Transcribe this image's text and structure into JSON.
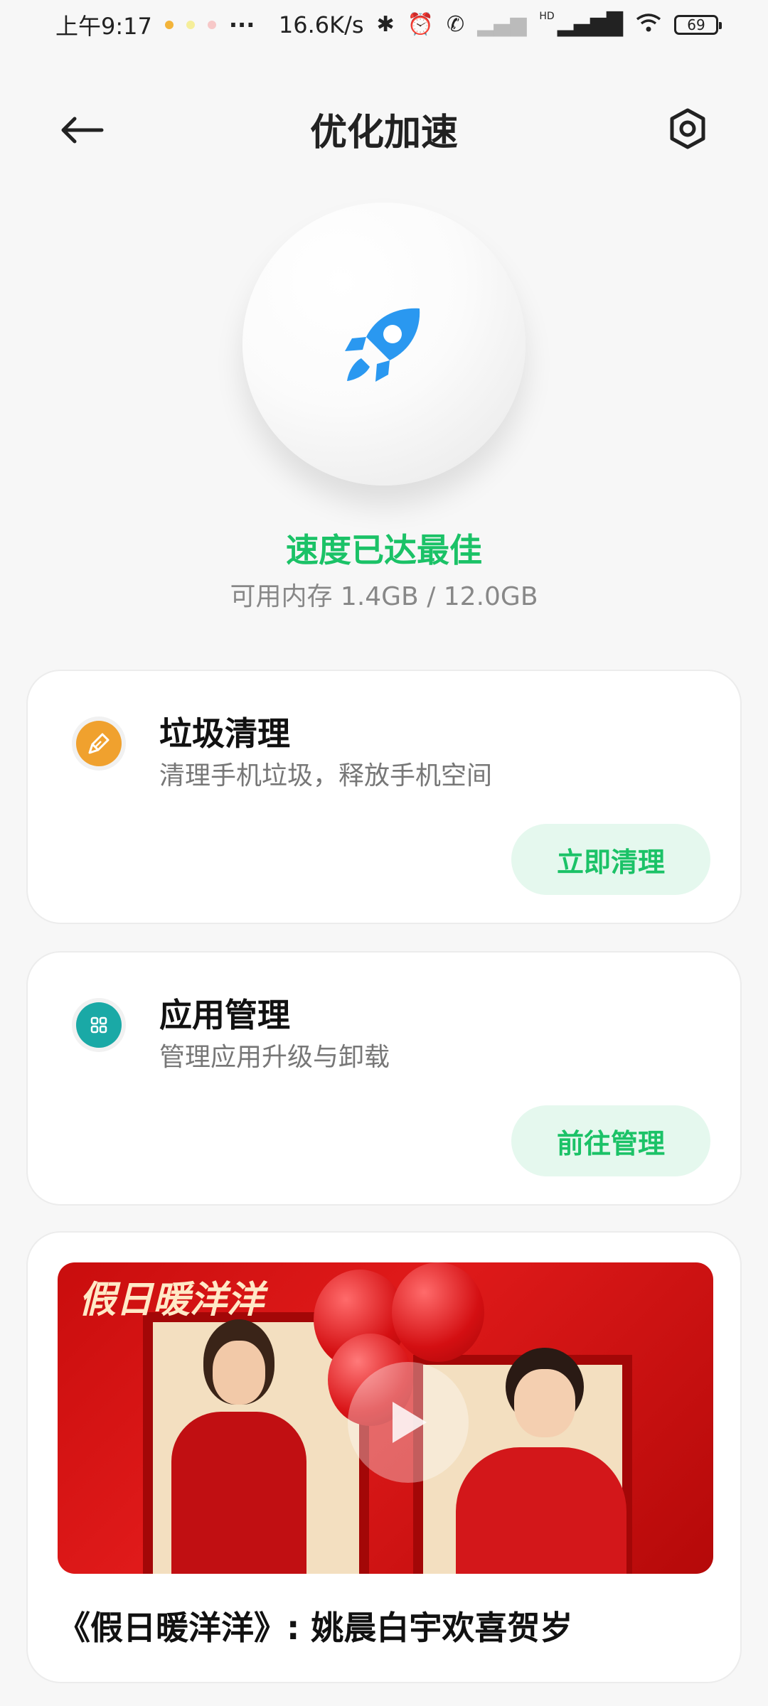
{
  "status_bar": {
    "time": "上午9:17",
    "more": "···",
    "net_speed": "16.6K/s",
    "battery": "69",
    "signal_label": "HD"
  },
  "header": {
    "title": "优化加速"
  },
  "hero": {
    "status": "速度已达最佳",
    "memory": "可用内存 1.4GB / 12.0GB"
  },
  "cards": [
    {
      "title": "垃圾清理",
      "description": "清理手机垃圾，释放手机空间",
      "button": "立即清理",
      "icon": "broom-icon",
      "icon_color": "#f0a12e"
    },
    {
      "title": "应用管理",
      "description": "管理应用升级与卸载",
      "button": "前往管理",
      "icon": "apps-grid-icon",
      "icon_color": "#1aa9a6"
    }
  ],
  "video": {
    "logo_text": "假日暖洋洋",
    "title": "《假日暖洋洋》: 姚晨白宇欢喜贺岁"
  },
  "colors": {
    "accent_green": "#1bc267",
    "button_bg": "#e5f8ee",
    "rocket_blue": "#2a98f0"
  }
}
